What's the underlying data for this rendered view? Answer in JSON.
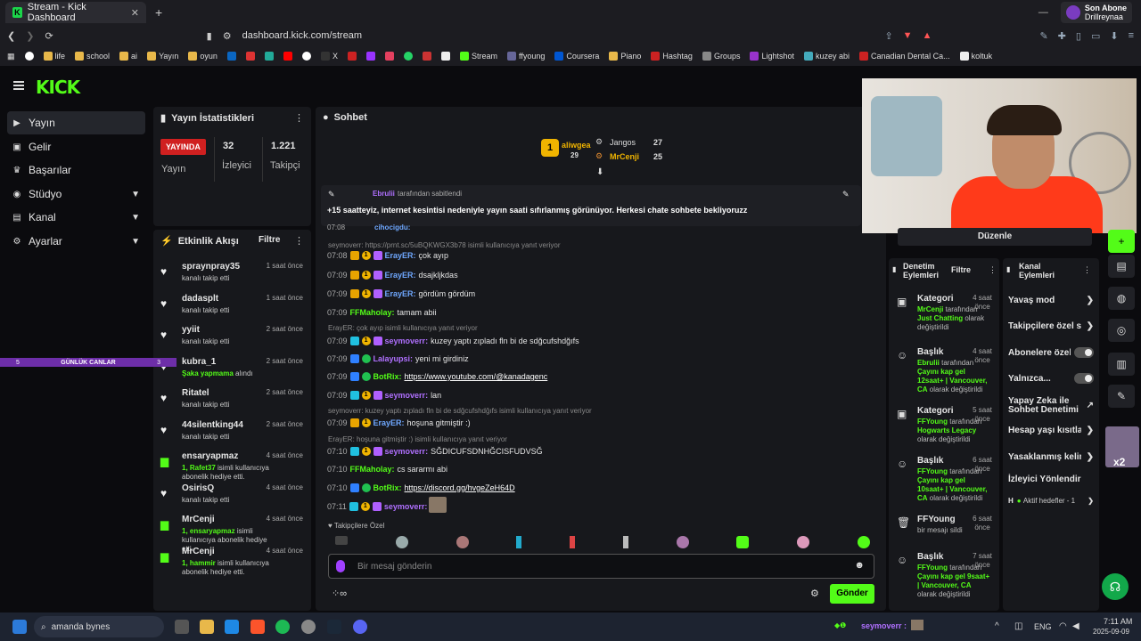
{
  "browser": {
    "tab_title": "Stream - Kick Dashboard",
    "tab_close": "✕",
    "new_tab": "+",
    "url": "dashboard.kick.com/stream",
    "profile_line1": "Son Abone",
    "profile_line2": "Drillreynaa",
    "bookmarks": [
      "life",
      "school",
      "ai",
      "Yayın",
      "oyun",
      "X",
      "Stream",
      "ffyoung",
      "Coursera",
      "Piano",
      "Hashtag",
      "Groups",
      "Lightshot",
      "kuzey abi",
      "Canadian Dental Ca...",
      "koltuk"
    ]
  },
  "sidebar": {
    "logo": "KICK",
    "items": [
      {
        "label": "Yayın",
        "icon": "broadcast-icon"
      },
      {
        "label": "Gelir",
        "icon": "money-icon"
      },
      {
        "label": "Başarılar",
        "icon": "trophy-icon"
      },
      {
        "label": "Stüdyo",
        "icon": "studio-icon"
      },
      {
        "label": "Kanal",
        "icon": "channel-icon"
      },
      {
        "label": "Ayarlar",
        "icon": "gear-icon"
      }
    ]
  },
  "stats": {
    "title": "Yayın İstatistikleri",
    "live_badge": "YAYINDA",
    "live_label": "Yayın",
    "viewers": "32",
    "viewers_label": "İzleyici",
    "followers": "1.221",
    "followers_label": "Takipçi"
  },
  "activity": {
    "title": "Etkinlik Akışı",
    "filter": "Filtre",
    "overlay": {
      "left": "5",
      "center": "GÜNLÜK CANLAR",
      "right": "3"
    },
    "events": [
      {
        "name": "spraynpray35",
        "time": "1 saat önce",
        "desc": "kanalı takip etti",
        "type": "follow"
      },
      {
        "name": "dadasplt",
        "time": "1 saat önce",
        "desc": "kanalı takip etti",
        "type": "follow"
      },
      {
        "name": "yyiit",
        "time": "2 saat önce",
        "desc": "kanalı takip etti",
        "type": "follow"
      },
      {
        "name": "kubra_1",
        "time": "2 saat önce",
        "desc_hl": "Şaka yapmama",
        "desc": " alındı",
        "type": "follow"
      },
      {
        "name": "Ritatel",
        "time": "2 saat önce",
        "desc": "kanalı takip etti",
        "type": "follow"
      },
      {
        "name": "44silentking44",
        "time": "2 saat önce",
        "desc": "kanalı takip etti",
        "type": "follow"
      },
      {
        "name": "ensaryapmaz",
        "time": "4 saat önce",
        "desc_hl": "1, Rafet37",
        "desc": " isimli kullanıcıya abonelik hediye etti.",
        "type": "gift"
      },
      {
        "name": "OsirisQ",
        "time": "4 saat önce",
        "desc": "kanalı takip etti",
        "type": "follow"
      },
      {
        "name": "MrCenji",
        "time": "4 saat önce",
        "desc_hl": "1, ensaryapmaz",
        "desc": " isimli kullanıcıya abonelik hediye etti.",
        "type": "gift"
      },
      {
        "name": "MrCenji",
        "time": "4 saat önce",
        "desc_hl": "1, hammir",
        "desc": " isimli kullanıcıya abonelik hediye etti.",
        "type": "gift"
      }
    ]
  },
  "chat": {
    "title": "Sohbet",
    "top": [
      {
        "name": "aliwgea",
        "count": "29"
      },
      {
        "name": "Jangos",
        "count": "27"
      },
      {
        "name": "MrCenji",
        "count": "25"
      }
    ],
    "pinned_by_name": "Ebrulii",
    "pinned_by_text": "tarafından sabitlendi",
    "pinned_message": "+15 saatteyiz, internet kesintisi nedeniyle yayın saati sıfırlanmış görünüyor. Herkesi chate sohbete bekliyoruzz",
    "partial_top": "07:08",
    "partial_user": "cihocigdu:",
    "reply_1": "seymoverr: https://prnt.sc/5uBQKWGX3b78 isimli kullanıcıya yanıt veriyor",
    "messages": [
      {
        "time": "07:08",
        "user": "ErayER:",
        "text": "çok ayıp",
        "color": "#6fa8ff"
      },
      {
        "time": "07:09",
        "user": "ErayER:",
        "text": "dsajkljkdas",
        "color": "#6fa8ff"
      },
      {
        "time": "07:09",
        "user": "ErayER:",
        "text": "gördüm gördüm",
        "color": "#6fa8ff"
      },
      {
        "time": "07:09",
        "user": "FFMaholay:",
        "text": "tamam abii",
        "color": "#53fc18"
      },
      {
        "time": "07:09",
        "user": "seymoverr:",
        "text": "kuzey yaptı zıpladı fln bi de sdğcufshdğıfs",
        "color": "#b070ff"
      },
      {
        "time": "07:09",
        "user": "Lalayupsi:",
        "text": "yeni mi girdiniz",
        "color": "#b070ff"
      },
      {
        "time": "07:09",
        "user": "BotRix:",
        "text": "https://www.youtube.com/@kanadagenc",
        "color": "#53fc18"
      },
      {
        "time": "07:09",
        "user": "seymoverr:",
        "text": "lan",
        "color": "#b070ff"
      },
      {
        "time": "07:09",
        "user": "ErayER:",
        "text": "hoşuna gitmiştir :)",
        "color": "#6fa8ff"
      },
      {
        "time": "07:10",
        "user": "seymoverr:",
        "text": "SĞDICUFSDNHĞCISFUDVSĞ",
        "color": "#b070ff"
      },
      {
        "time": "07:10",
        "user": "FFMaholay:",
        "text": "cs sararmı abi",
        "color": "#53fc18"
      },
      {
        "time": "07:10",
        "user": "BotRix:",
        "text": "https://discord.gg/hvgeZeH64D",
        "color": "#53fc18"
      },
      {
        "time": "07:11",
        "user": "seymoverr:",
        "text": "",
        "color": "#b070ff"
      }
    ],
    "reply_2": "ErayER: çok ayıp isimli kullanıcıya yanıt veriyor",
    "reply_3": "seymoverr: kuzey yaptı zıpladı fln bi de sdğcufshdğıfs isimli kullanıcıya yanıt veriyor",
    "reply_4": "ErayER: hoşuna gitmiştir :) isimli kullanıcıya yanıt veriyor",
    "followers_only": "Takipçilere Özel",
    "input_placeholder": "Bir mesaj gönderin",
    "send": "Gönder"
  },
  "camera": {
    "edit": "Düzenle"
  },
  "moderation": {
    "title": "Denetim Eylemleri",
    "filter": "Filtre",
    "items": [
      {
        "title": "Kategori",
        "time": "4 saat önce",
        "user": "MrCenji",
        "mid": " tarafından ",
        "hl": "Just Chatting",
        "tail": " olarak değiştirildi"
      },
      {
        "title": "Başlık",
        "time": "4 saat önce",
        "user": "Ebrulii",
        "mid": " tarafından ",
        "hl": "Çayını kap gel 12saat+ | Vancouver, CA",
        "tail": " olarak değiştirildi"
      },
      {
        "title": "Kategori",
        "time": "5 saat önce",
        "user": "FFYoung",
        "mid": " tarafından ",
        "hl": "Hogwarts Legacy",
        "tail": " olarak değiştirildi"
      },
      {
        "title": "Başlık",
        "time": "6 saat önce",
        "user": "FFYoung",
        "mid": " tarafından ",
        "hl": "Çayını kap gel 10saat+ | Vancouver, CA",
        "tail": " olarak değiştirildi"
      },
      {
        "title": "FFYoung",
        "time": "6 saat önce",
        "user": "",
        "mid": "",
        "hl": "",
        "tail": "bir mesajı sildi"
      },
      {
        "title": "Başlık",
        "time": "7 saat önce",
        "user": "FFYoung",
        "mid": " tarafından ",
        "hl": "Çayını kap gel 9saat+ | Vancouver, CA",
        "tail": " olarak değiştirildi"
      }
    ]
  },
  "channel_actions": {
    "title": "Kanal Eylemleri",
    "items": [
      "Yavaş mod",
      "Takipçilere özel sohbet",
      "Abonelere özel",
      "Yalnızca...",
      "Yapay Zeka ile Sohbet Denetimi",
      "Hesap yaşı kısıtlaması",
      "Yasaklanmış kelimeler",
      "İzleyici Yönlendir"
    ],
    "goals_h": "H",
    "goals": "Aktif hedefler - 1"
  },
  "side_badge": "x2",
  "taskbar": {
    "search": "amanda bynes",
    "lang": "ENG",
    "time": "7:11 AM",
    "date": "2025-09-09",
    "notif_user": "seymoverr :"
  }
}
